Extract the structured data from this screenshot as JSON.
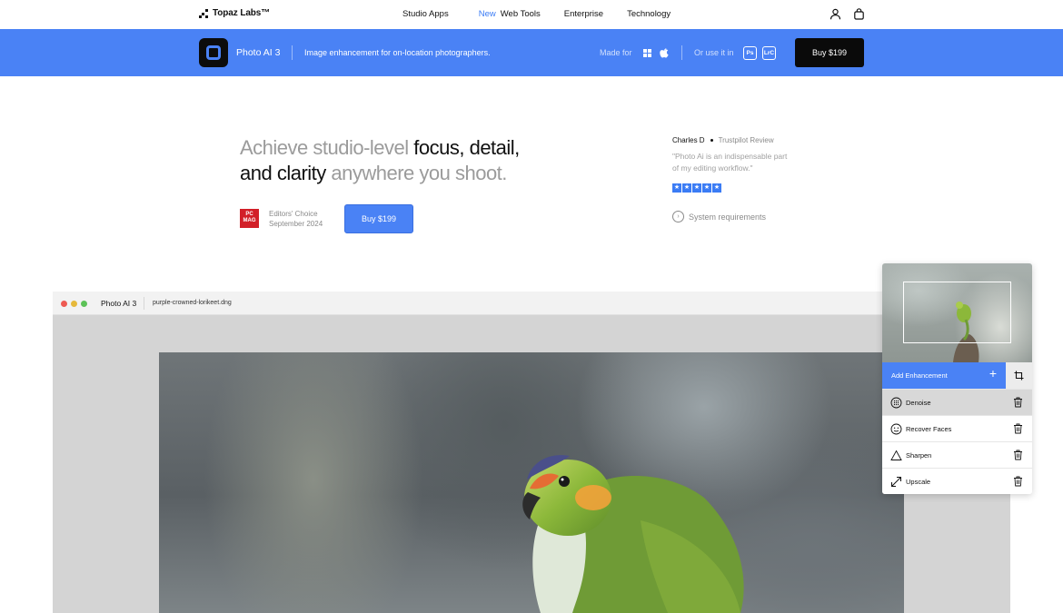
{
  "nav": {
    "logo": "Topaz Labs™",
    "links": {
      "studio_apps": "Studio Apps",
      "new_badge": "New",
      "web_tools": "Web Tools",
      "enterprise": "Enterprise",
      "technology": "Technology"
    },
    "icons": [
      "user-icon",
      "bag-icon"
    ]
  },
  "product_bar": {
    "name": "Photo AI 3",
    "tagline": "Image enhancement for on-location photographers.",
    "made_for": "Made for",
    "platform_icons": [
      "windows-icon",
      "apple-icon"
    ],
    "or_use": "Or use it in",
    "plugins": [
      "Ps",
      "LrC"
    ],
    "buy_label": "Buy  $199",
    "accent": "#4a82f5"
  },
  "hero": {
    "headline_grey_1": "Achieve studio-level ",
    "headline_dark_1": "focus, detail,",
    "headline_dark_2": "and clarity",
    "headline_grey_2": " anywhere you shoot.",
    "badge": "PC MAG",
    "award_line1": "Editors' Choice",
    "award_line2": "September 2024",
    "buy_label": "Buy  $199"
  },
  "review": {
    "author": "Charles D",
    "source": "Trustpilot Review",
    "quote": "\"Photo Ai is an indispensable part of my editing workflow.\"",
    "rating": 5,
    "system_requirements": "System requirements"
  },
  "app_window": {
    "title": "Photo AI 3",
    "filename": "purple-crowned-lorikeet.dng"
  },
  "panel": {
    "add_label": "Add Enhancement",
    "enhancements": [
      {
        "label": "Denoise",
        "icon": "denoise-icon",
        "active": true
      },
      {
        "label": "Recover Faces",
        "icon": "face-icon",
        "active": false
      },
      {
        "label": "Sharpen",
        "icon": "triangle-icon",
        "active": false
      },
      {
        "label": "Upscale",
        "icon": "expand-arrows-icon",
        "active": false
      }
    ]
  }
}
